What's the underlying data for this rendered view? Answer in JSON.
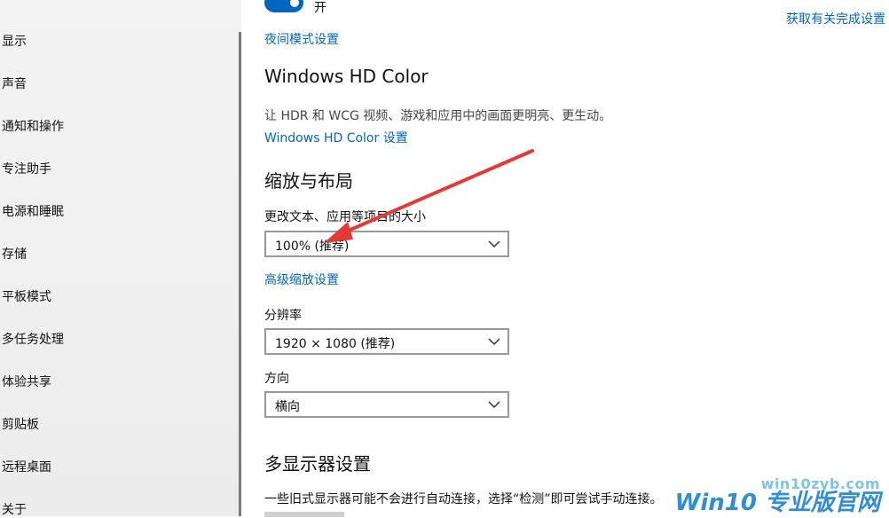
{
  "sidebar": {
    "items": [
      {
        "label": "显示"
      },
      {
        "label": "声音"
      },
      {
        "label": "通知和操作"
      },
      {
        "label": "专注助手"
      },
      {
        "label": "电源和睡眠"
      },
      {
        "label": "存储"
      },
      {
        "label": "平板模式"
      },
      {
        "label": "多任务处理"
      },
      {
        "label": "体验共享"
      },
      {
        "label": "剪贴板"
      },
      {
        "label": "远程桌面"
      },
      {
        "label": "关于"
      }
    ]
  },
  "top": {
    "toggle_label": "开",
    "toggle_on": true,
    "night_link": "夜间模式设置",
    "help_link": "获取有关完成设置"
  },
  "hdr": {
    "title": "Windows HD Color",
    "desc": "让 HDR 和 WCG 视频、游戏和应用中的画面更明亮、更生动。",
    "link": "Windows HD Color 设置"
  },
  "scale": {
    "title": "缩放与布局",
    "size_label": "更改文本、应用等项目的大小",
    "size_value": "100% (推荐)",
    "advanced_link": "高级缩放设置",
    "resolution_label": "分辨率",
    "resolution_value": "1920 × 1080 (推荐)",
    "orientation_label": "方向",
    "orientation_value": "横向"
  },
  "multi": {
    "title": "多显示器设置",
    "desc": "一些旧式显示器可能不会进行自动连接，选择“检测”即可尝试手动连接。"
  },
  "watermark": {
    "url": "win10zyb.com",
    "name": "Win10 专业版官网"
  },
  "colors": {
    "accent": "#0067c0",
    "arrow": "#e53935"
  },
  "icons": [
    "chevron-down-icon"
  ]
}
